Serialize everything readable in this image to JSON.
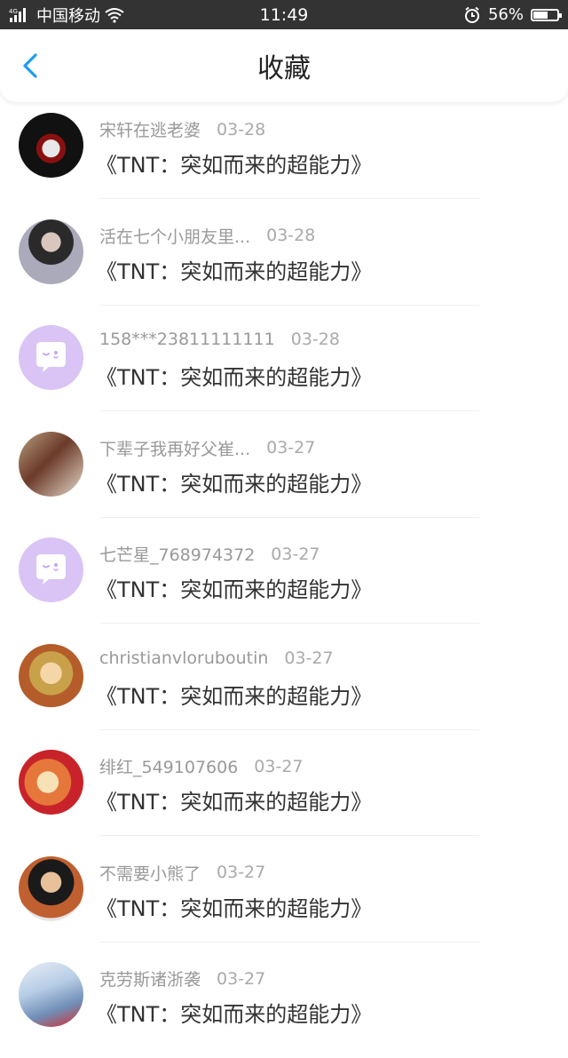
{
  "status_bar": {
    "network": "4G",
    "carrier": "中国移动",
    "time": "11:49",
    "battery": "56%",
    "battery_level": 0.56
  },
  "header": {
    "title": "收藏",
    "back_icon": "chevron-left-icon",
    "accent_color": "#1e9bf0"
  },
  "favorites": [
    {
      "user": "宋轩在逃老婆",
      "date": "03-28",
      "title": "《TNT：突如而来的超能力》",
      "avatar": "photo"
    },
    {
      "user": "活在七个小朋友里...",
      "date": "03-28",
      "title": "《TNT：突如而来的超能力》",
      "avatar": "photo"
    },
    {
      "user": "158***23811111111",
      "date": "03-28",
      "title": "《TNT：突如而来的超能力》",
      "avatar": "default-chat-icon"
    },
    {
      "user": "下辈子我再好父崔...",
      "date": "03-27",
      "title": "《TNT：突如而来的超能力》",
      "avatar": "photo"
    },
    {
      "user": "七芒星_768974372",
      "date": "03-27",
      "title": "《TNT：突如而来的超能力》",
      "avatar": "default-chat-icon"
    },
    {
      "user": "christianvloruboutin",
      "date": "03-27",
      "title": "《TNT：突如而来的超能力》",
      "avatar": "photo"
    },
    {
      "user": "绯红_549107606",
      "date": "03-27",
      "title": "《TNT：突如而来的超能力》",
      "avatar": "photo"
    },
    {
      "user": "不需要小熊了",
      "date": "03-27",
      "title": "《TNT：突如而来的超能力》",
      "avatar": "photo"
    },
    {
      "user": "克劳斯诸浙袭",
      "date": "03-27",
      "title": "《TNT：突如而来的超能力》",
      "avatar": "photo"
    }
  ]
}
